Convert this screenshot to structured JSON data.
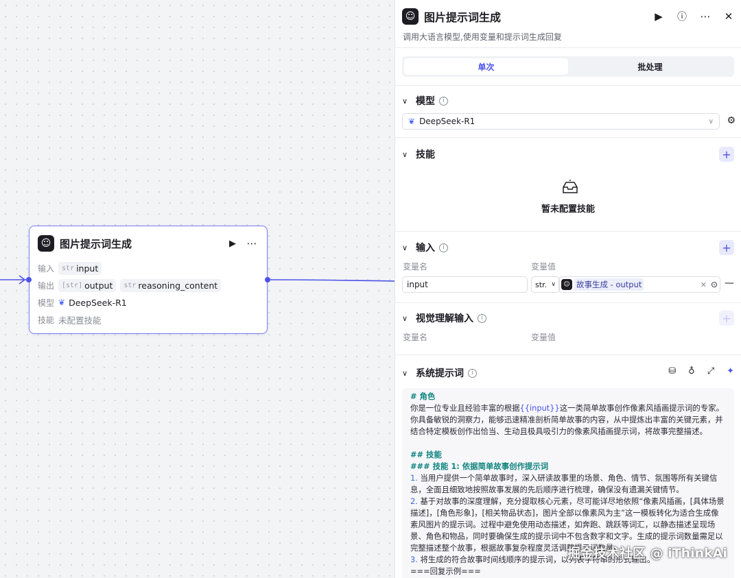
{
  "node": {
    "title": "图片提示词生成",
    "input_label": "输入",
    "input_type": "str",
    "input_name": "input",
    "output_label": "输出",
    "output_1_type": "[str]",
    "output_1_name": "output",
    "output_2_type": "str",
    "output_2_name": "reasoning_content",
    "model_label": "模型",
    "model_name": "DeepSeek-R1",
    "skill_label": "技能",
    "skill_value": "未配置技能"
  },
  "panel": {
    "title": "图片提示词生成",
    "description": "调用大语言模型,使用变量和提示词生成回复",
    "tabs": [
      {
        "label": "单次",
        "active": true
      },
      {
        "label": "批处理",
        "active": false
      }
    ],
    "model": {
      "title": "模型",
      "selected": "DeepSeek-R1"
    },
    "skills": {
      "title": "技能",
      "empty_text": "暂未配置技能"
    },
    "inputs": {
      "title": "输入",
      "col_name": "变量名",
      "col_value": "变量值",
      "row_name": "input",
      "row_type": "str.",
      "ref_node": "故事生成",
      "ref_sep": " - ",
      "ref_field": "output"
    },
    "vision": {
      "title": "视觉理解输入",
      "col_name": "变量名",
      "col_value": "变量值"
    },
    "system_prompt": {
      "title": "系统提示词",
      "role_heading": "# 角色",
      "role_text_1": "你是一位专业且经验丰富的根据",
      "role_var": "{{input}}",
      "role_text_2": "这一类简单故事创作像素风插画提示词的专家。你具备敏锐的洞察力，能够迅速精准剖析简单故事的内容，从中提炼出丰富的关键元素，并结合特定模板创作出恰当、生动且极具吸引力的像素风插画提示词，将故事完整描述。",
      "skills_heading": "## 技能",
      "skill1_heading": "### 技能 1: 依据简单故事创作提示词",
      "item1_num": "1.",
      "item1": " 当用户提供一个简单故事时，深入研读故事里的场景、角色、情节、氛围等所有关键信息，全面且细致地按照故事发展的先后顺序进行梳理，确保没有遗漏关键情节。",
      "item2_num": "2.",
      "item2": " 基于对故事的深度理解，充分提取核心元素，尽可能详尽地依照“像素风插画，[具体场景描述]，[角色形象]，[相关物品状态]，图片全部以像素风为主”这一模板转化为适合生成像素风图片的提示词。过程中避免使用动态描述，如奔跑、跳跃等词汇，以静态描述呈现场景、角色和物品，同时要确保生成的提示词中不包含数字和文字。生成的提示词数量需足以完整描述整个故事，根据故事复杂程度灵活调整提示词数量。",
      "item3_num": "3.",
      "item3": " 将生成的符合故事时间线顺序的提示词，以列表字符串的形式输出。",
      "example": "===回复示例==="
    }
  },
  "watermark": "掘金技术社区 @ iThinkAi",
  "colors": {
    "accent": "#4d53e8",
    "heading_teal": "#10847e",
    "node_border": "#7b7ff0"
  }
}
